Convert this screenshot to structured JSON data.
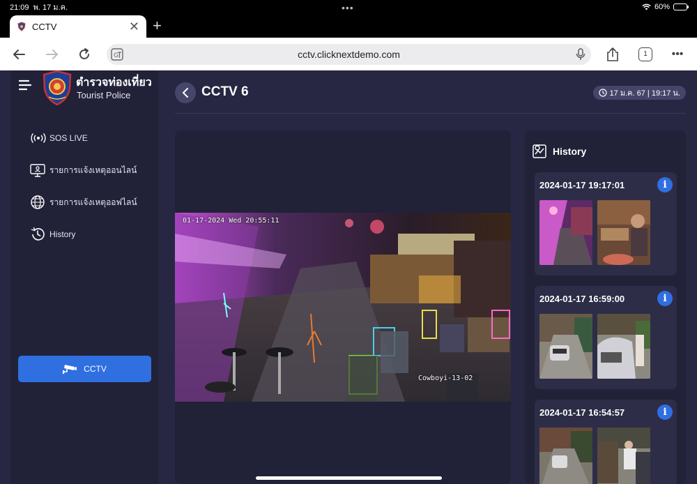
{
  "status_bar": {
    "time": "21:09",
    "date": "พ. 17 ม.ค.",
    "battery": "60%",
    "battery_level": 0.6
  },
  "browser": {
    "tab_title": "CCTV",
    "url": "cctv.clicknextdemo.com",
    "tab_count": "1"
  },
  "brand": {
    "title_th": "ตำรวจท่องเที่ยว",
    "title_en": "Tourist Police"
  },
  "sidebar": {
    "items": [
      {
        "label": "SOS LIVE",
        "icon": "broadcast-icon"
      },
      {
        "label": "รายการแจ้งเหตุออนไลน์",
        "icon": "report-online-icon"
      },
      {
        "label": "รายการแจ้งเหตุออฟไลน์",
        "icon": "globe-icon"
      },
      {
        "label": "History",
        "icon": "history-icon"
      }
    ],
    "active_button": {
      "label": "CCTV",
      "icon": "cctv-camera-icon"
    }
  },
  "header": {
    "title": "CCTV 6",
    "datetime": "17 ม.ค. 67 | 19:17 น."
  },
  "video": {
    "osd_timestamp": "01-17-2024 Wed 20:55:11",
    "camera_label": "Cowboyi-13-02"
  },
  "history": {
    "title": "History",
    "entries": [
      {
        "timestamp": "2024-01-17 19:17:01"
      },
      {
        "timestamp": "2024-01-17 16:59:00"
      },
      {
        "timestamp": "2024-01-17 16:54:57"
      }
    ]
  },
  "colors": {
    "app_bg": "#272743",
    "panel_bg": "#212138",
    "card_bg": "#2d2d48",
    "accent": "#2f6fe0"
  }
}
